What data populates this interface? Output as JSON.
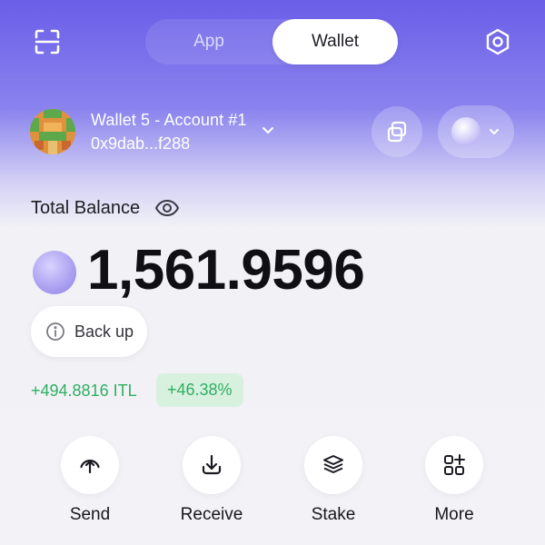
{
  "header": {
    "tabs": [
      {
        "label": "App",
        "active": false
      },
      {
        "label": "Wallet",
        "active": true
      }
    ]
  },
  "account": {
    "name": "Wallet 5 - Account #1",
    "address": "0x9dab...f288"
  },
  "balance": {
    "label": "Total Balance",
    "amount": "1,561.9596",
    "backup_label": "Back up",
    "change_amount": "+494.8816 ITL",
    "change_percent": "+46.38%"
  },
  "actions": [
    {
      "label": "Send",
      "icon": "send-icon"
    },
    {
      "label": "Receive",
      "icon": "receive-icon"
    },
    {
      "label": "Stake",
      "icon": "stake-icon"
    },
    {
      "label": "More",
      "icon": "more-icon"
    }
  ],
  "colors": {
    "accent": "#6a5ee8",
    "positive": "#2fae62",
    "positive_bg": "#d8f1df"
  }
}
